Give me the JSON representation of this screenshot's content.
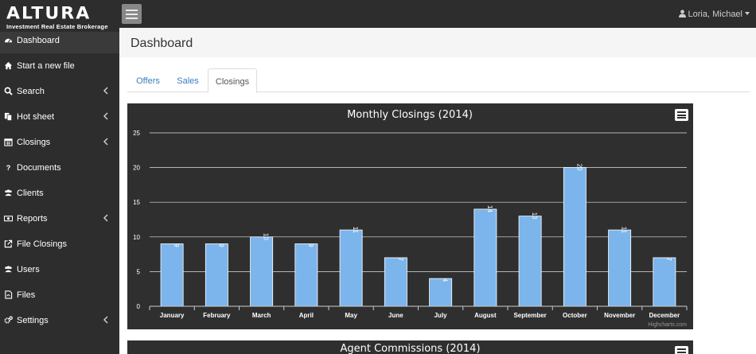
{
  "brand": {
    "name": "ALTURA",
    "tagline": "Investment Real Estate Brokerage"
  },
  "user": {
    "name": "Loria, Michael"
  },
  "sidebar": {
    "items": [
      {
        "label": "Dashboard",
        "icon": "dashboard-icon",
        "has_submenu": false
      },
      {
        "label": "Start a new file",
        "icon": "home-icon",
        "has_submenu": false
      },
      {
        "label": "Search",
        "icon": "search-icon",
        "has_submenu": true
      },
      {
        "label": "Hot sheet",
        "icon": "documents-icon",
        "has_submenu": true
      },
      {
        "label": "Closings",
        "icon": "calendar-icon",
        "has_submenu": true
      },
      {
        "label": "Documents",
        "icon": "question-icon",
        "has_submenu": false
      },
      {
        "label": "Clients",
        "icon": "users-icon",
        "has_submenu": false
      },
      {
        "label": "Reports",
        "icon": "money-icon",
        "has_submenu": true
      },
      {
        "label": "File Closings",
        "icon": "external-link-icon",
        "has_submenu": false
      },
      {
        "label": "Users",
        "icon": "users-icon",
        "has_submenu": false
      },
      {
        "label": "Files",
        "icon": "file-pdf-icon",
        "has_submenu": false
      },
      {
        "label": "Settings",
        "icon": "gears-icon",
        "has_submenu": true
      }
    ]
  },
  "page": {
    "title": "Dashboard"
  },
  "tabs": [
    {
      "label": "Offers",
      "active": false
    },
    {
      "label": "Sales",
      "active": false
    },
    {
      "label": "Closings",
      "active": true
    }
  ],
  "charts": {
    "credit": "Highcharts.com",
    "second_title": "Agent Commissions (2014)"
  },
  "colors": {
    "bar": "#7cb5ec",
    "panel": "#2f2f2f",
    "sidebar": "#2d2d2d",
    "tab_link": "#3a7dbb"
  },
  "chart_data": {
    "type": "bar",
    "title": "Monthly Closings (2014)",
    "categories": [
      "January",
      "February",
      "March",
      "April",
      "May",
      "June",
      "July",
      "August",
      "September",
      "October",
      "November",
      "December"
    ],
    "values": [
      9,
      9,
      10,
      9,
      11,
      7,
      4,
      14,
      13,
      20,
      11,
      7
    ],
    "ylim": [
      0,
      25
    ],
    "yticks": [
      0,
      5,
      10,
      15,
      20,
      25
    ],
    "xlabel": "",
    "ylabel": "",
    "grid": true,
    "data_labels": true
  }
}
